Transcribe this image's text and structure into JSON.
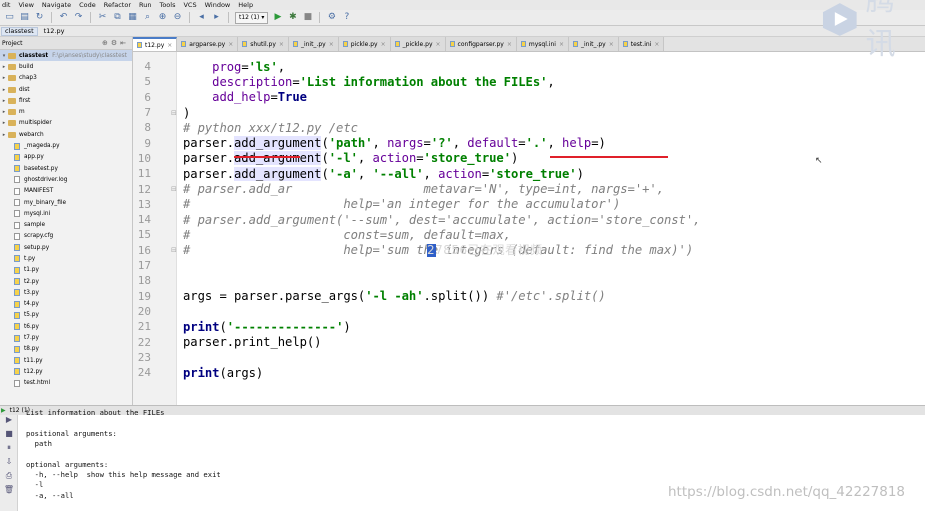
{
  "menu": [
    "dit",
    "View",
    "Navigate",
    "Code",
    "Refactor",
    "Run",
    "Tools",
    "VCS",
    "Window",
    "Help"
  ],
  "toolbar": {
    "run_config": "t12 (1)",
    "icons": [
      "folder-icon",
      "save-icon",
      "sync-icon",
      "back-icon",
      "forward-icon",
      "cut-icon",
      "copy-icon",
      "paste-icon",
      "search-icon",
      "zoom-in-icon",
      "zoom-out-icon",
      "nav-back-icon",
      "nav-forward-icon",
      "run-icon",
      "debug-icon",
      "stop-icon",
      "settings-icon",
      "help-icon"
    ]
  },
  "breadcrumb": [
    "classtest",
    "t12.py"
  ],
  "project": {
    "header": "Project",
    "root_name": "classtest",
    "root_path": "F:\\p\\anses\\study\\classtest",
    "items": [
      {
        "name": "build",
        "type": "folder"
      },
      {
        "name": "chap3",
        "type": "folder"
      },
      {
        "name": "dist",
        "type": "folder"
      },
      {
        "name": "first",
        "type": "folder"
      },
      {
        "name": "m",
        "type": "folder"
      },
      {
        "name": "multispider",
        "type": "folder"
      },
      {
        "name": "webarch",
        "type": "folder"
      },
      {
        "name": "_mageda.py",
        "type": "py"
      },
      {
        "name": "app.py",
        "type": "py"
      },
      {
        "name": "basetest.py",
        "type": "py"
      },
      {
        "name": "ghostdriver.log",
        "type": "txt"
      },
      {
        "name": "MANIFEST",
        "type": "txt"
      },
      {
        "name": "my_binary_file",
        "type": "txt"
      },
      {
        "name": "mysql.ini",
        "type": "txt"
      },
      {
        "name": "sample",
        "type": "txt"
      },
      {
        "name": "scrapy.cfg",
        "type": "txt"
      },
      {
        "name": "setup.py",
        "type": "py"
      },
      {
        "name": "t.py",
        "type": "py"
      },
      {
        "name": "t1.py",
        "type": "py"
      },
      {
        "name": "t2.py",
        "type": "py"
      },
      {
        "name": "t3.py",
        "type": "py"
      },
      {
        "name": "t4.py",
        "type": "py"
      },
      {
        "name": "t5.py",
        "type": "py"
      },
      {
        "name": "t6.py",
        "type": "py"
      },
      {
        "name": "t7.py",
        "type": "py"
      },
      {
        "name": "t8.py",
        "type": "py"
      },
      {
        "name": "t11.py",
        "type": "py"
      },
      {
        "name": "t12.py",
        "type": "py"
      },
      {
        "name": "test.html",
        "type": "txt"
      }
    ]
  },
  "tabs": [
    "t12.py",
    "argparse.py",
    "shutil.py",
    "_init_.py",
    "pickle.py",
    "_pickle.py",
    "configparser.py",
    "mysql.ini",
    "_init_.py",
    "test.ini"
  ],
  "editor": {
    "lines": [
      {
        "n": "4",
        "html": "    <span class=\"param\">prog</span>=<span class=\"str\">'ls'</span>,"
      },
      {
        "n": "5",
        "html": "    <span class=\"param\">description</span>=<span class=\"str\">'List information about the FILEs'</span>,"
      },
      {
        "n": "6",
        "html": "    <span class=\"param\">add_help</span>=<span class=\"kw\">True</span>"
      },
      {
        "n": "7",
        "html": ")"
      },
      {
        "n": "8",
        "html": "<span class=\"cm\"># python xxx/t12.py /etc</span>"
      },
      {
        "n": "9",
        "html": "parser.<span class=\"hl\">add_argument</span>(<span class=\"str\">'path'</span>, <span class=\"param\">nargs</span>=<span class=\"str\">'?'</span>, <span class=\"param\">default</span>=<span class=\"str\">'.'</span>, <span class=\"param\">help</span>=)"
      },
      {
        "n": "10",
        "html": "parser.<span class=\"hl\">add_argument</span>(<span class=\"str\">'-l'</span>, <span class=\"param\">action</span>=<span class=\"str\">'store_true'</span>)"
      },
      {
        "n": "11",
        "html": "parser.<span class=\"hl\">add_argument</span>(<span class=\"str\">'-a'</span>, <span class=\"str\">'--all'</span>, <span class=\"param\">action</span>=<span class=\"str\">'store_true'</span>)"
      },
      {
        "n": "12",
        "html": "<span class=\"cm\"># parser.add_ar                  metavar='N', type=int, nargs='+',</span>"
      },
      {
        "n": "13",
        "html": "<span class=\"cm\">#                     help='an integer for the accumulator')</span>"
      },
      {
        "n": "14",
        "html": "<span class=\"cm\"># parser.add_argument('--sum', dest='accumulate', action='store_const',</span>"
      },
      {
        "n": "15",
        "html": "<span class=\"cm\">#                     const=sum, default=max,</span>"
      },
      {
        "n": "16",
        "html": "<span class=\"cm\">#                     help='sum the integers (default: find the max)')</span>"
      },
      {
        "n": "17",
        "html": ""
      },
      {
        "n": "18",
        "html": ""
      },
      {
        "n": "19",
        "html": "args = parser.parse_args(<span class=\"str\">'-l -ah'</span>.split()) <span class=\"cm\">#'/etc'.split()</span>"
      },
      {
        "n": "20",
        "html": ""
      },
      {
        "n": "21",
        "html": "<span class=\"kw\">print</span>(<span class=\"str\">'--------------'</span>)"
      },
      {
        "n": "22",
        "html": "parser.print_help()"
      },
      {
        "n": "23",
        "html": ""
      },
      {
        "n": "24",
        "html": "<span class=\"kw\">print</span>(args)"
      }
    ],
    "overlay_text": "27856已在观看视频"
  },
  "run": {
    "label": "t12 (1)",
    "console": [
      "List information about the FILEs",
      "",
      "positional arguments:",
      "  path",
      "",
      "optional arguments:",
      "  -h, --help  show this help message and exit",
      "  -l",
      "  -a, --all"
    ]
  },
  "logo": {
    "text": "腾讯"
  },
  "watermark": "https://blog.csdn.net/qq_42227818",
  "colors": {
    "accent": "#4a7cc7",
    "underline": "#e0202a",
    "string": "#008000",
    "keyword": "#000080",
    "comment": "#808080",
    "param": "#660099"
  }
}
